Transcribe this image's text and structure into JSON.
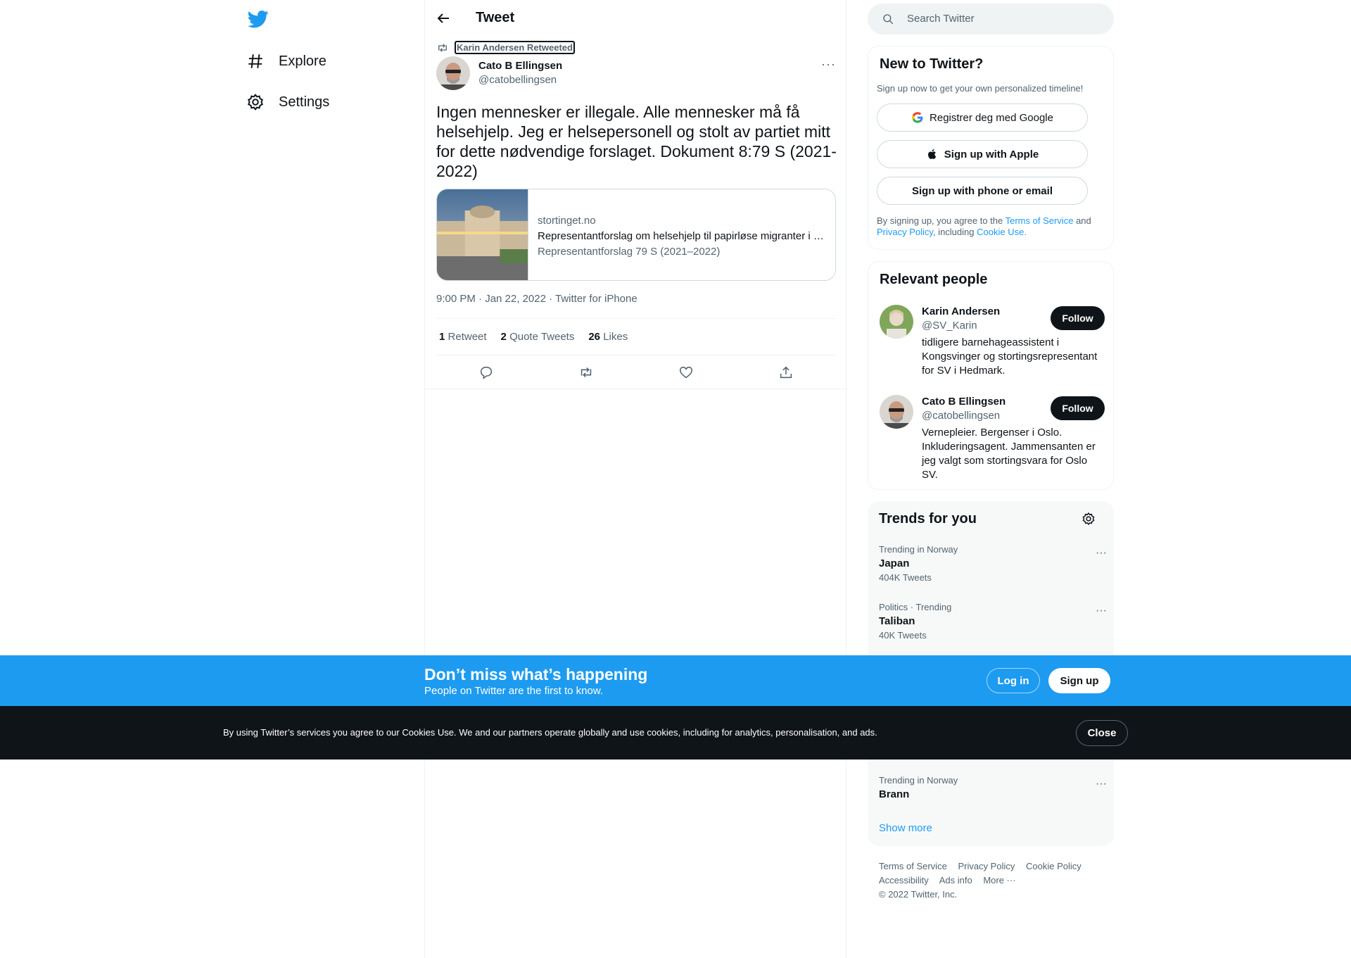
{
  "nav": {
    "items": [
      {
        "label": "Explore",
        "icon": "hashtag-icon"
      },
      {
        "label": "Settings",
        "icon": "gear-icon"
      }
    ]
  },
  "header": {
    "title": "Tweet"
  },
  "tweet": {
    "retweeted_by": "Karin Andersen Retweeted",
    "author_name": "Cato B Ellingsen",
    "author_handle": "@catobellingsen",
    "text": "Ingen mennesker er illegale. Alle mennesker må få helsehjelp. Jeg er helsepersonell og stolt av partiet mitt for dette nødvendige forslaget. Dokument 8:79 S (2021-2022)",
    "card": {
      "domain": "stortinget.no",
      "title": "Representantforslag om helsehjelp til papirløse migranter i …",
      "description": "Representantforslag 79 S (2021–2022)"
    },
    "meta": "9:00 PM · Jan 22, 2022 · Twitter for iPhone",
    "stats": {
      "retweets_count": "1",
      "retweets_label": "Retweet",
      "quotes_count": "2",
      "quotes_label": "Quote Tweets",
      "likes_count": "26",
      "likes_label": "Likes"
    }
  },
  "search": {
    "placeholder": "Search Twitter"
  },
  "new_to_twitter": {
    "title": "New to Twitter?",
    "subtitle": "Sign up now to get your own personalized timeline!",
    "google_label": "Registrer deg med Google",
    "apple_label": "Sign up with Apple",
    "phone_label": "Sign up with phone or email",
    "legal_1": "By signing up, you agree to the",
    "legal_tos": "Terms of Service",
    "legal_2": "and",
    "legal_privacy": "Privacy Policy",
    "legal_3": ", including",
    "legal_cookie": "Cookie Use."
  },
  "relevant_people": {
    "title": "Relevant people",
    "people": [
      {
        "name": "Karin Andersen",
        "handle": "@SV_Karin",
        "bio": "tidligere barnehageassistent i Kongsvinger og stortingsrepresentant for SV i Hedmark.",
        "button": "Follow"
      },
      {
        "name": "Cato B Ellingsen",
        "handle": "@catobellingsen",
        "bio": "Vernepleier. Bergenser i Oslo. Inkluderingsagent. Jammensanten er jeg valgt som stortingsvara for Oslo SV.",
        "button": "Follow"
      }
    ]
  },
  "trends": {
    "title": "Trends for you",
    "items": [
      {
        "context": "Trending in Norway",
        "name": "Japan",
        "count": "404K Tweets"
      },
      {
        "context": "Politics · Trending",
        "name": "Taliban",
        "count": "40K Tweets"
      },
      {
        "context": "Trending in Norway",
        "name": "Brann",
        "count": ""
      }
    ],
    "show_more": "Show more"
  },
  "footer": {
    "links": [
      "Terms of Service",
      "Privacy Policy",
      "Cookie Policy",
      "Accessibility",
      "Ads info",
      "More ···"
    ],
    "copyright": "© 2022 Twitter, Inc."
  },
  "signup_bar": {
    "heading": "Don’t miss what’s happening",
    "sub": "People on Twitter are the first to know.",
    "login": "Log in",
    "signup": "Sign up"
  },
  "cookie_bar": {
    "text": "By using Twitter’s services you agree to our Cookies Use. We and our partners operate globally and use cookies, including for analytics, personalisation, and ads.",
    "close": "Close"
  },
  "colors": {
    "brand": "#1d9bf0",
    "text": "#0f1419",
    "muted": "#536471",
    "dark": "#0f1419"
  }
}
